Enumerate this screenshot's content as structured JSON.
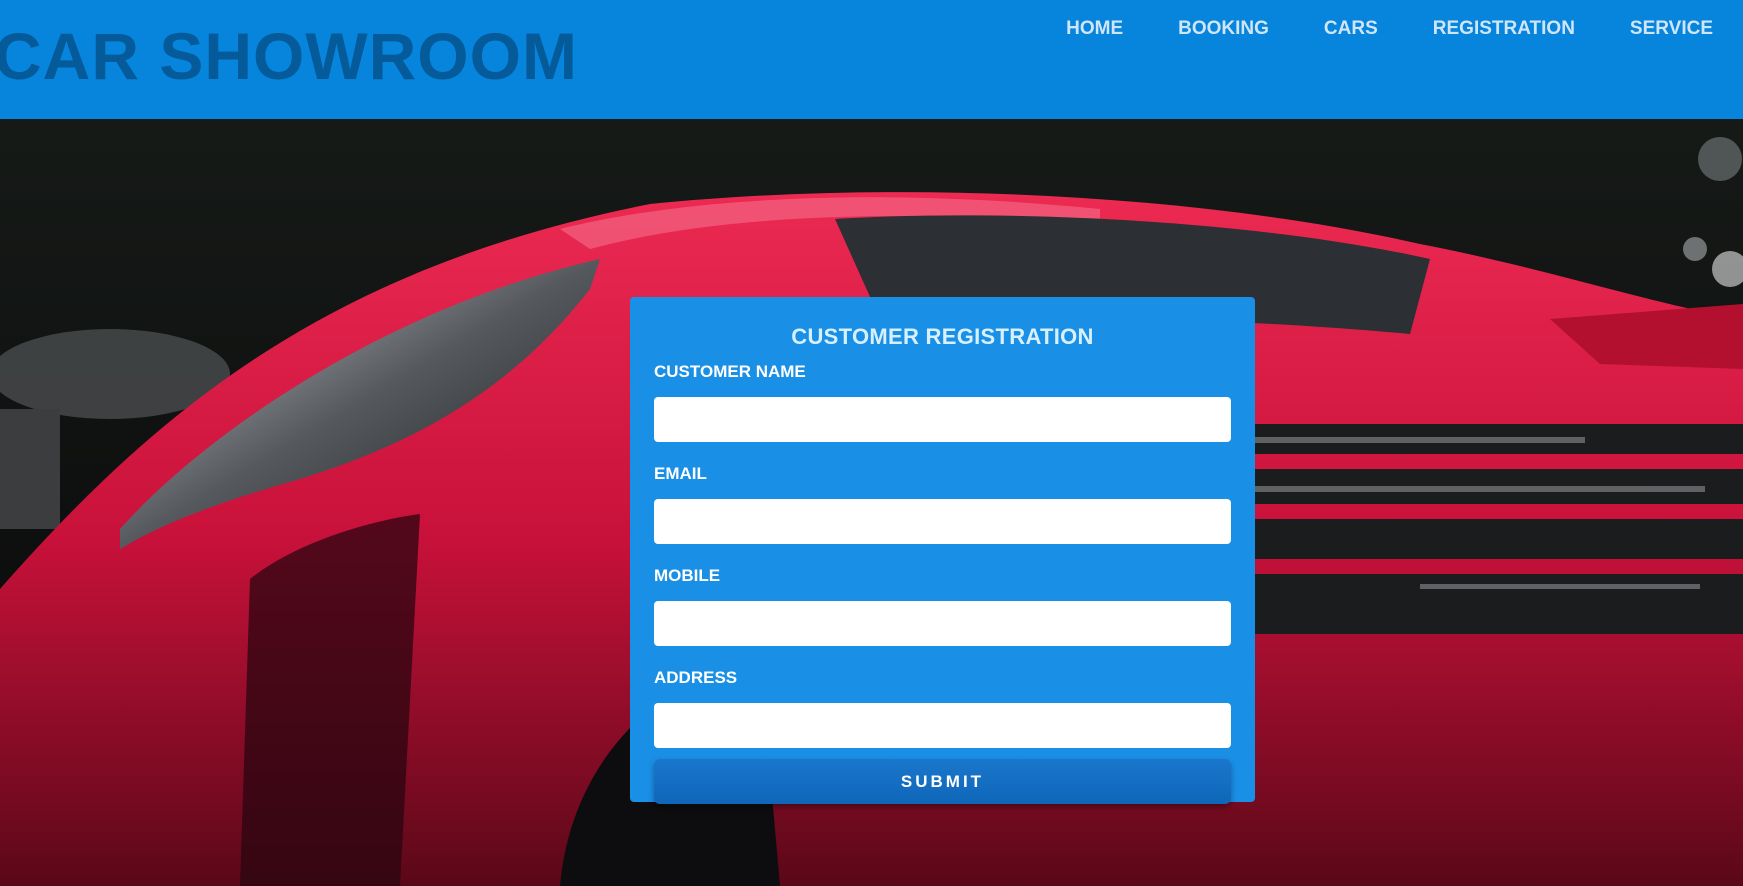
{
  "header": {
    "brand": "CAR SHOWROOM",
    "nav": [
      {
        "label": "HOME"
      },
      {
        "label": "BOOKING"
      },
      {
        "label": "CARS"
      },
      {
        "label": "REGISTRATION"
      },
      {
        "label": "SERVICE"
      }
    ]
  },
  "form": {
    "title": "CUSTOMER REGISTRATION",
    "fields": [
      {
        "label": "CUSTOMER NAME",
        "value": ""
      },
      {
        "label": "EMAIL",
        "value": ""
      },
      {
        "label": "MOBILE",
        "value": ""
      },
      {
        "label": "ADDRESS",
        "value": ""
      }
    ],
    "submit_label": "SUBMIT"
  },
  "colors": {
    "header_bg": "#0784dc",
    "brand_text": "#055a99",
    "card_bg": "#1a8fe6",
    "car_red": "#d3163a"
  }
}
